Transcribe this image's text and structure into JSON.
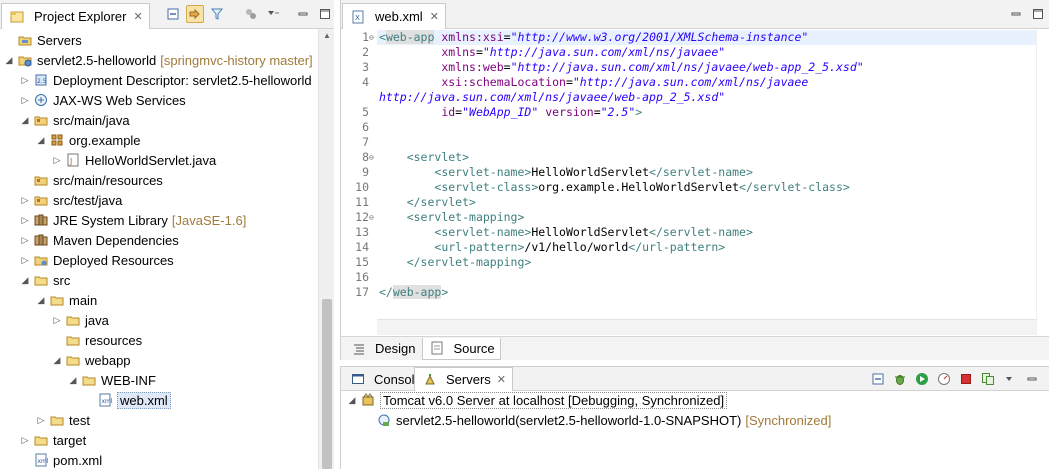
{
  "explorer": {
    "title": "Project Explorer",
    "close_glyph": "✕",
    "toolbar_icons": [
      "collapse-all-icon",
      "link-with-editor-icon",
      "filter-icon",
      "extra-icon",
      "view-menu-icon",
      "minimize-icon",
      "maximize-icon"
    ],
    "tree": [
      {
        "depth": 0,
        "expand": "none",
        "icon": "server-folder",
        "label": "Servers",
        "decoration": ""
      },
      {
        "depth": 0,
        "expand": "open",
        "icon": "web-project",
        "label": "servlet2.5-helloworld",
        "decoration": "[springmvc-history master]"
      },
      {
        "depth": 1,
        "expand": "closed",
        "icon": "deployment-descriptor",
        "label": "Deployment Descriptor: servlet2.5-helloworld",
        "decoration": ""
      },
      {
        "depth": 1,
        "expand": "closed",
        "icon": "web-services",
        "label": "JAX-WS Web Services",
        "decoration": ""
      },
      {
        "depth": 1,
        "expand": "open",
        "icon": "source-folder",
        "label": "src/main/java",
        "decoration": ""
      },
      {
        "depth": 2,
        "expand": "open",
        "icon": "package",
        "label": "org.example",
        "decoration": ""
      },
      {
        "depth": 3,
        "expand": "closed",
        "icon": "java-file",
        "label": "HelloWorldServlet.java",
        "decoration": ""
      },
      {
        "depth": 1,
        "expand": "none",
        "icon": "source-folder",
        "label": "src/main/resources",
        "decoration": ""
      },
      {
        "depth": 1,
        "expand": "closed",
        "icon": "source-folder",
        "label": "src/test/java",
        "decoration": ""
      },
      {
        "depth": 1,
        "expand": "closed",
        "icon": "library",
        "label": "JRE System Library",
        "decoration": "[JavaSE-1.6]"
      },
      {
        "depth": 1,
        "expand": "closed",
        "icon": "library",
        "label": "Maven Dependencies",
        "decoration": ""
      },
      {
        "depth": 1,
        "expand": "closed",
        "icon": "deployed-resources",
        "label": "Deployed Resources",
        "decoration": ""
      },
      {
        "depth": 1,
        "expand": "open",
        "icon": "folder",
        "label": "src",
        "decoration": ""
      },
      {
        "depth": 2,
        "expand": "open",
        "icon": "folder",
        "label": "main",
        "decoration": ""
      },
      {
        "depth": 3,
        "expand": "closed",
        "icon": "folder",
        "label": "java",
        "decoration": ""
      },
      {
        "depth": 3,
        "expand": "none",
        "icon": "folder",
        "label": "resources",
        "decoration": ""
      },
      {
        "depth": 3,
        "expand": "open",
        "icon": "folder",
        "label": "webapp",
        "decoration": ""
      },
      {
        "depth": 4,
        "expand": "open",
        "icon": "folder",
        "label": "WEB-INF",
        "decoration": ""
      },
      {
        "depth": 5,
        "expand": "none",
        "icon": "xml-file",
        "label": "web.xml",
        "decoration": "",
        "selected": true
      },
      {
        "depth": 2,
        "expand": "closed",
        "icon": "folder",
        "label": "test",
        "decoration": ""
      },
      {
        "depth": 1,
        "expand": "closed",
        "icon": "folder",
        "label": "target",
        "decoration": ""
      },
      {
        "depth": 1,
        "expand": "none",
        "icon": "xml-file",
        "label": "pom.xml",
        "decoration": ""
      }
    ]
  },
  "editor": {
    "tab_title": "web.xml",
    "close_glyph": "✕",
    "bottom_tabs": [
      {
        "icon": "design-icon",
        "label": "Design",
        "active": false
      },
      {
        "icon": "source-icon",
        "label": "Source",
        "active": true
      }
    ],
    "lines": [
      {
        "n": "1",
        "fold": "⊖",
        "segs": [
          [
            "t",
            "<"
          ],
          [
            "t",
            "web-app"
          ],
          [
            "tx",
            " "
          ],
          [
            "an",
            "xmlns:xsi"
          ],
          [
            "tx",
            "="
          ],
          [
            "av",
            "\"http://www.w3.org/2001/XMLSchema-instance\""
          ]
        ]
      },
      {
        "n": "2",
        "fold": "",
        "segs": [
          [
            "tx",
            "         "
          ],
          [
            "an",
            "xmlns"
          ],
          [
            "tx",
            "="
          ],
          [
            "av",
            "\"http://java.sun.com/xml/ns/javaee\""
          ]
        ]
      },
      {
        "n": "3",
        "fold": "",
        "segs": [
          [
            "tx",
            "         "
          ],
          [
            "an",
            "xmlns:web"
          ],
          [
            "tx",
            "="
          ],
          [
            "av",
            "\"http://java.sun.com/xml/ns/javaee/web-app_2_5.xsd\""
          ]
        ]
      },
      {
        "n": "4",
        "fold": "",
        "segs": [
          [
            "tx",
            "         "
          ],
          [
            "an",
            "xsi:schemaLocation"
          ],
          [
            "tx",
            "="
          ],
          [
            "av",
            "\"http://java.sun.com/xml/ns/javaee"
          ]
        ]
      },
      {
        "n": "",
        "fold": "",
        "wrap": true,
        "segs": [
          [
            "av",
            "http://java.sun.com/xml/ns/javaee/web-app_2_5.xsd\""
          ]
        ]
      },
      {
        "n": "5",
        "fold": "",
        "segs": [
          [
            "tx",
            "         "
          ],
          [
            "an",
            "id"
          ],
          [
            "tx",
            "="
          ],
          [
            "av",
            "\"WebApp_ID\""
          ],
          [
            "tx",
            " "
          ],
          [
            "an",
            "version"
          ],
          [
            "tx",
            "="
          ],
          [
            "av",
            "\"2.5\""
          ],
          [
            "t",
            ">"
          ]
        ]
      },
      {
        "n": "6",
        "fold": "",
        "segs": []
      },
      {
        "n": "7",
        "fold": "",
        "segs": []
      },
      {
        "n": "8",
        "fold": "⊖",
        "segs": [
          [
            "tx",
            "    "
          ],
          [
            "t",
            "<servlet>"
          ]
        ]
      },
      {
        "n": "9",
        "fold": "",
        "segs": [
          [
            "tx",
            "        "
          ],
          [
            "t",
            "<servlet-name>"
          ],
          [
            "tx",
            "HelloWorldServlet"
          ],
          [
            "t",
            "</servlet-name>"
          ]
        ]
      },
      {
        "n": "10",
        "fold": "",
        "segs": [
          [
            "tx",
            "        "
          ],
          [
            "t",
            "<servlet-class>"
          ],
          [
            "tx",
            "org.example.HelloWorldServlet"
          ],
          [
            "t",
            "</servlet-class>"
          ]
        ]
      },
      {
        "n": "11",
        "fold": "",
        "segs": [
          [
            "tx",
            "    "
          ],
          [
            "t",
            "</servlet>"
          ]
        ]
      },
      {
        "n": "12",
        "fold": "⊖",
        "segs": [
          [
            "tx",
            "    "
          ],
          [
            "t",
            "<servlet-mapping>"
          ]
        ]
      },
      {
        "n": "13",
        "fold": "",
        "segs": [
          [
            "tx",
            "        "
          ],
          [
            "t",
            "<servlet-name>"
          ],
          [
            "tx",
            "HelloWorldServlet"
          ],
          [
            "t",
            "</servlet-name>"
          ]
        ]
      },
      {
        "n": "14",
        "fold": "",
        "segs": [
          [
            "tx",
            "        "
          ],
          [
            "t",
            "<url-pattern>"
          ],
          [
            "tx",
            "/v1/hello/world"
          ],
          [
            "t",
            "</url-pattern>"
          ]
        ]
      },
      {
        "n": "15",
        "fold": "",
        "segs": [
          [
            "tx",
            "    "
          ],
          [
            "t",
            "</servlet-mapping>"
          ]
        ]
      },
      {
        "n": "16",
        "fold": "",
        "segs": []
      },
      {
        "n": "17",
        "fold": "",
        "segs": [
          [
            "t",
            "</"
          ],
          [
            "t",
            "web-app"
          ],
          [
            "t",
            ">"
          ]
        ]
      }
    ]
  },
  "servers_panel": {
    "tabs": [
      {
        "icon": "console-icon",
        "label": "Console",
        "active": false
      },
      {
        "icon": "servers-icon",
        "label": "Servers",
        "active": true
      }
    ],
    "close_glyph": "✕",
    "toolbar_icons": [
      "collapse-all-icon",
      "debug-icon",
      "start-icon",
      "profile-icon",
      "stop-icon",
      "publish-icon",
      "view-menu-icon",
      "minimize-icon",
      "maximize-icon"
    ],
    "server": {
      "label": "Tomcat v6.0 Server at localhost",
      "state": "[Debugging, Synchronized]"
    },
    "module": {
      "label": "servlet2.5-helloworld(servlet2.5-helloworld-1.0-SNAPSHOT)",
      "state": "[Synchronized]"
    }
  },
  "colors": {
    "tag": "#3f7f7f",
    "attr_name": "#7f007f",
    "attr_value": "#2a00ff",
    "decoration": "#a07a3a"
  }
}
